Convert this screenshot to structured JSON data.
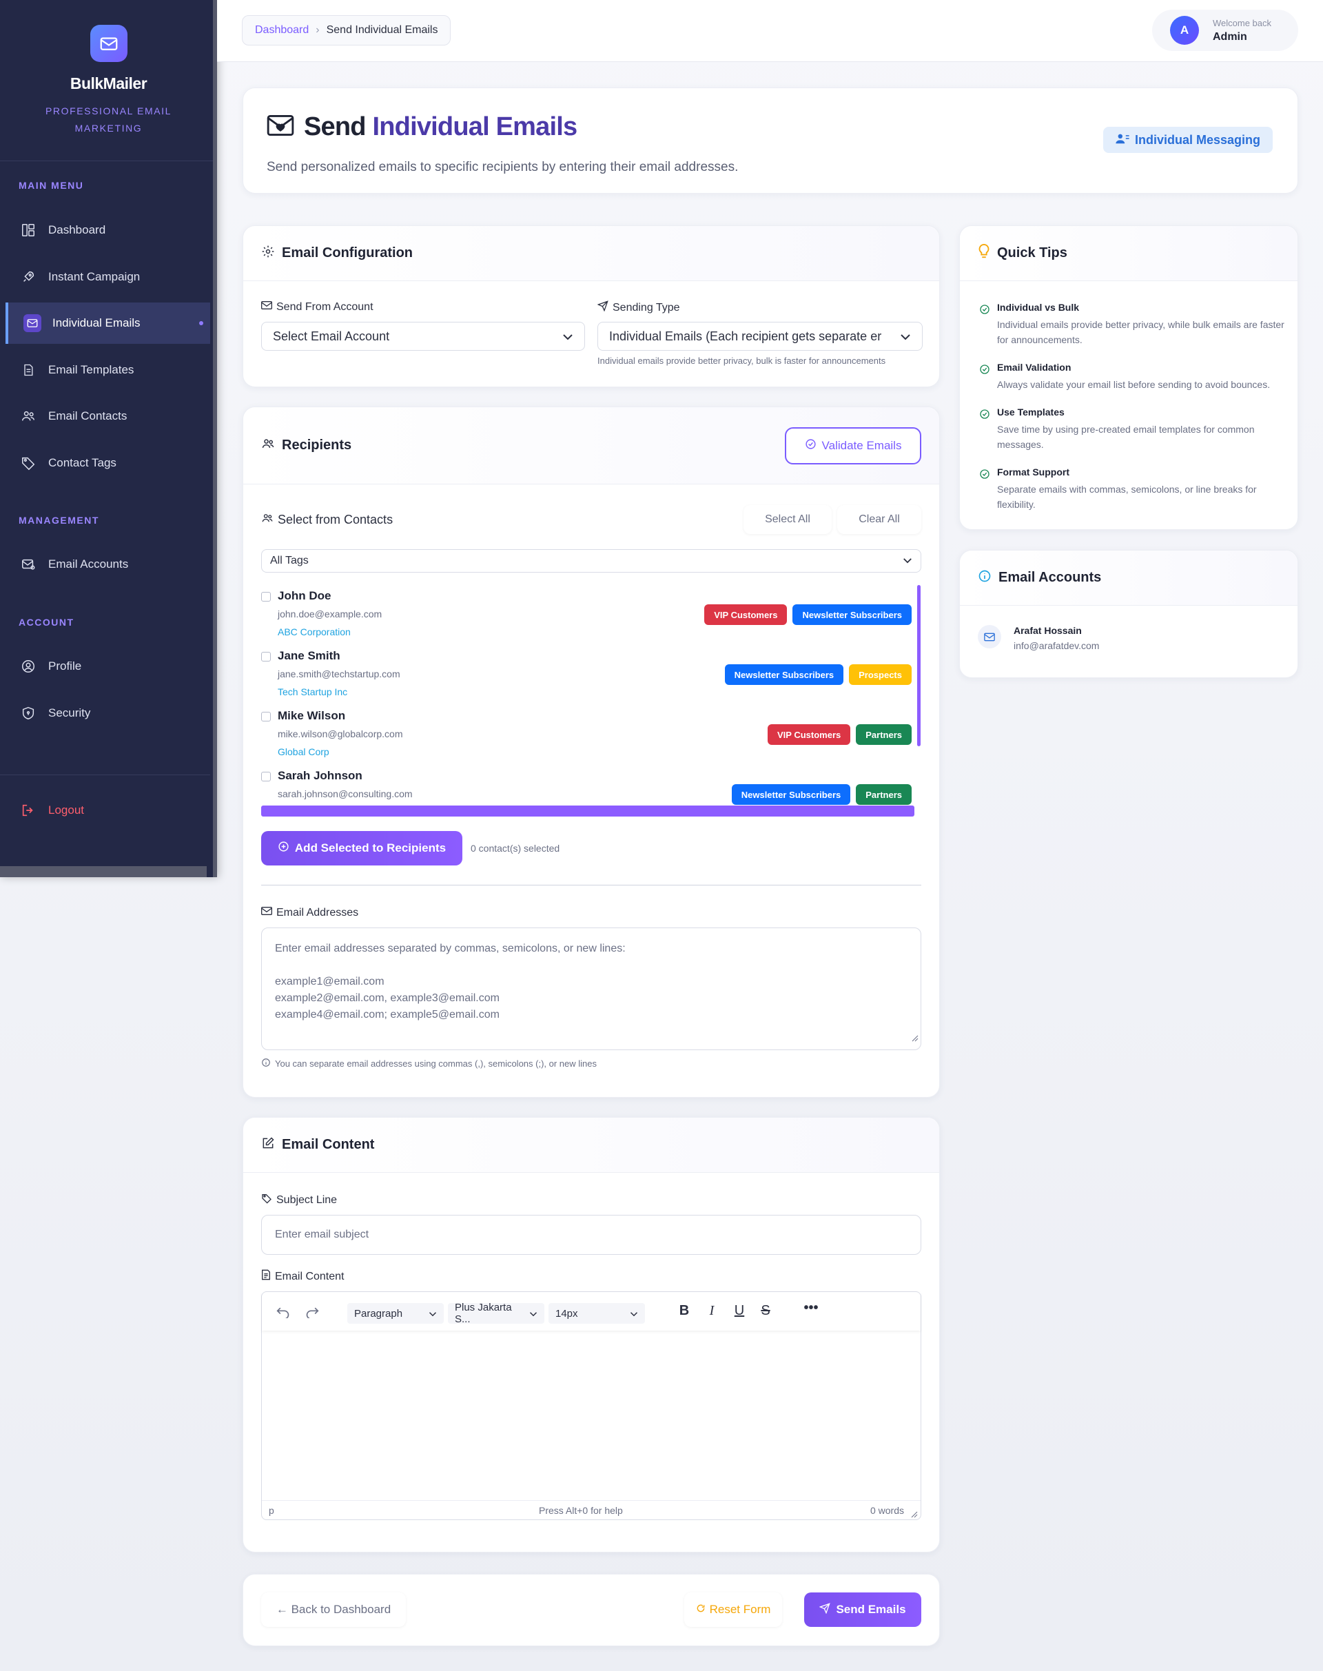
{
  "sidebar": {
    "brand_name": "BulkMailer",
    "brand_tagline": "PROFESSIONAL EMAIL MARKETING",
    "sections": {
      "main": "MAIN MENU",
      "management": "MANAGEMENT",
      "account": "ACCOUNT"
    },
    "items": {
      "dashboard": "Dashboard",
      "instant_campaign": "Instant Campaign",
      "individual_emails": "Individual Emails",
      "email_templates": "Email Templates",
      "email_contacts": "Email Contacts",
      "contact_tags": "Contact Tags",
      "email_accounts": "Email Accounts",
      "profile": "Profile",
      "security": "Security",
      "logout": "Logout"
    }
  },
  "topbar": {
    "breadcrumb_link": "Dashboard",
    "breadcrumb_sep": "›",
    "breadcrumb_current": "Send Individual Emails",
    "welcome": "Welcome back",
    "user_name": "Admin",
    "avatar_initial": "A"
  },
  "hero": {
    "title_prefix": "Send",
    "title_rest": "Individual Emails",
    "subtitle": "Send personalized emails to specific recipients by entering their email addresses.",
    "badge": "Individual Messaging"
  },
  "config": {
    "title": "Email Configuration",
    "from_label": "Send From Account",
    "from_value": "Select Email Account",
    "type_label": "Sending Type",
    "type_value": "Individual Emails (Each recipient gets separate er",
    "type_hint": "Individual emails provide better privacy, bulk is faster for announcements"
  },
  "recipients": {
    "title": "Recipients",
    "validate_button": "Validate Emails",
    "select_from": "Select from Contacts",
    "select_all": "Select All",
    "clear_all": "Clear All",
    "tag_filter": "All Tags",
    "contacts": [
      {
        "name": "John Doe",
        "email": "john.doe@example.com",
        "company": "ABC Corporation",
        "tags": [
          "VIP Customers",
          "Newsletter Subscribers"
        ]
      },
      {
        "name": "Jane Smith",
        "email": "jane.smith@techstartup.com",
        "company": "Tech Startup Inc",
        "tags": [
          "Newsletter Subscribers",
          "Prospects"
        ]
      },
      {
        "name": "Mike Wilson",
        "email": "mike.wilson@globalcorp.com",
        "company": "Global Corp",
        "tags": [
          "VIP Customers",
          "Partners"
        ]
      },
      {
        "name": "Sarah Johnson",
        "email": "sarah.johnson@consulting.com",
        "company": "",
        "tags": [
          "Newsletter Subscribers",
          "Partners"
        ]
      }
    ],
    "add_selected": "Add Selected to Recipients",
    "selected_count": "0 contact(s) selected",
    "addresses_label": "Email Addresses",
    "addresses_placeholder_l1": "Enter email addresses separated by commas, semicolons, or new lines:",
    "addresses_placeholder_l2": "example1@email.com",
    "addresses_placeholder_l3": "example2@email.com, example3@email.com",
    "addresses_placeholder_l4": "example4@email.com; example5@email.com",
    "addresses_hint": "You can separate email addresses using commas (,), semicolons (;), or new lines"
  },
  "content": {
    "title": "Email Content",
    "subject_label": "Subject Line",
    "subject_placeholder": "Enter email subject",
    "body_label": "Email Content",
    "format_select": "Paragraph",
    "font_select": "Plus Jakarta S...",
    "size_select": "14px",
    "status_path": "p",
    "status_help": "Press Alt+0 for help",
    "status_words": "0 words"
  },
  "actions": {
    "back": "← Back to Dashboard",
    "reset": "Reset Form",
    "send": "Send Emails"
  },
  "tips": {
    "title": "Quick Tips",
    "items": [
      {
        "title": "Individual vs Bulk",
        "desc": "Individual emails provide better privacy, while bulk emails are faster for announcements."
      },
      {
        "title": "Email Validation",
        "desc": "Always validate your email list before sending to avoid bounces."
      },
      {
        "title": "Use Templates",
        "desc": "Save time by using pre-created email templates for common messages."
      },
      {
        "title": "Format Support",
        "desc": "Separate emails with commas, semicolons, or line breaks for flexibility."
      }
    ]
  },
  "accounts": {
    "title": "Email Accounts",
    "name": "Arafat Hossain",
    "email": "info@arafatdev.com"
  },
  "colors": {
    "accent": "#7a5cff",
    "sidebar_bg": "#232846",
    "tag_vip": "#dc3545",
    "tag_newsletter": "#0d6efd",
    "tag_prospects": "#ffc107",
    "tag_partners": "#198754"
  }
}
